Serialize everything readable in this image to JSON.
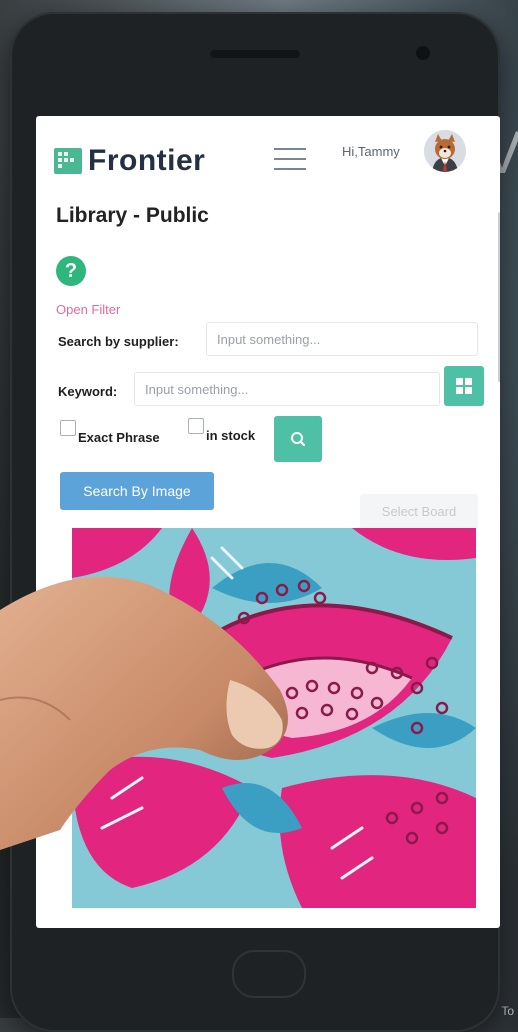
{
  "background": {
    "partial_letter": "V",
    "corner_text": "To"
  },
  "app": {
    "brand": "Frontier",
    "greeting": "Hi,Tammy",
    "page_title": "Library - Public"
  },
  "filter": {
    "open_filter_label": "Open Filter",
    "supplier_label": "Search by supplier:",
    "supplier_placeholder": "Input something...",
    "keyword_label": "Keyword:",
    "keyword_placeholder": "Input something...",
    "exact_phrase_label": "Exact Phrase",
    "in_stock_label": "in stock",
    "search_by_image_label": "Search By Image",
    "select_board_label": "Select Board"
  },
  "icons": {
    "help": "question-circle-icon",
    "search": "search-icon",
    "grid": "grid-icon",
    "menu": "hamburger-icon"
  },
  "colors": {
    "brand_green": "#4cb893",
    "teal_button": "#4ec0a5",
    "image_button": "#5ba3d9",
    "filter_link": "#e46a9a",
    "fabric_pink": "#e8237d",
    "fabric_blue": "#7fc4d2"
  }
}
